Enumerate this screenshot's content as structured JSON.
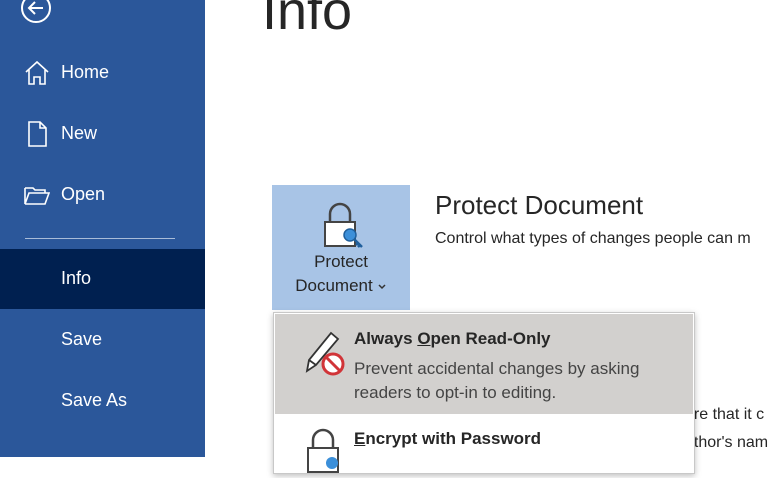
{
  "sidebar": {
    "items": [
      {
        "id": "home",
        "label": "Home"
      },
      {
        "id": "new",
        "label": "New"
      },
      {
        "id": "open",
        "label": "Open"
      },
      {
        "id": "info",
        "label": "Info"
      },
      {
        "id": "save",
        "label": "Save"
      },
      {
        "id": "save_as",
        "label": "Save As"
      }
    ],
    "selected": "Info"
  },
  "page": {
    "title": "Info"
  },
  "protect": {
    "button_line1": "Protect",
    "button_line2": "Document",
    "heading": "Protect Document",
    "description": "Control what types of changes people can m"
  },
  "background_peek": {
    "line1": "are that it c",
    "line2": "uthor's nam"
  },
  "menu": {
    "items": [
      {
        "title_pre": "Always ",
        "title_accel": "O",
        "title_post": "pen Read-Only",
        "description": "Prevent accidental changes by asking readers to opt-in to editing."
      },
      {
        "title_pre": "",
        "title_accel": "E",
        "title_post": "ncrypt with Password"
      }
    ]
  },
  "colors": {
    "sidebar_bg": "#2b579a",
    "sidebar_selected": "#002050",
    "button_bg": "#a8c4e6",
    "menu_hover": "#d2d0ce"
  }
}
